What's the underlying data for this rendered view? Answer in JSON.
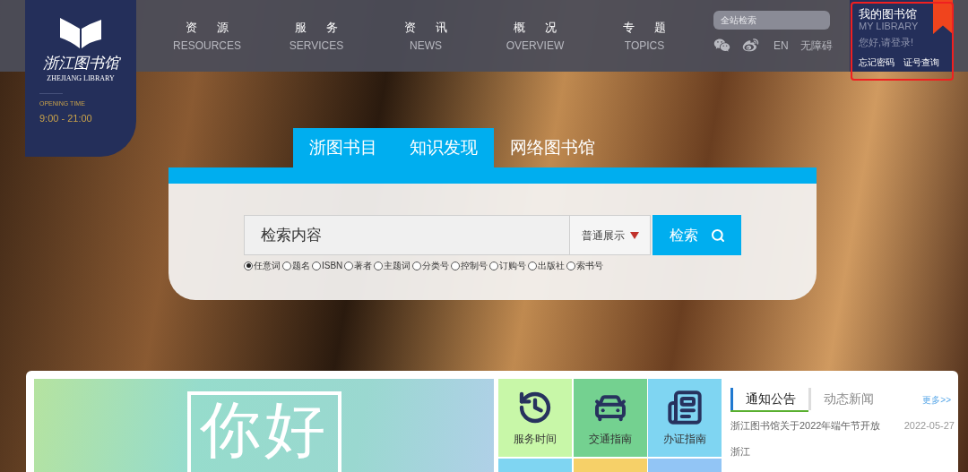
{
  "logo": {
    "name_cn": "浙江图书馆",
    "name_en": "ZHEJIANG LIBRARY",
    "opening_label": "OPENING TIME",
    "opening_hours": "9:00 - 21:00"
  },
  "nav": [
    {
      "cn": "资源",
      "en": "RESOURCES"
    },
    {
      "cn": "服务",
      "en": "SERVICES"
    },
    {
      "cn": "资讯",
      "en": "NEWS"
    },
    {
      "cn": "概况",
      "en": "OVERVIEW"
    },
    {
      "cn": "专题",
      "en": "TOPICS"
    }
  ],
  "site_search": {
    "placeholder": "全站检索"
  },
  "language": "EN",
  "accessibility": "无障碍",
  "my_library": {
    "title": "我的图书馆",
    "subtitle": "MY LIBRARY",
    "greeting": "您好,请登录!",
    "links": [
      "忘记密码",
      "证号查询"
    ]
  },
  "search": {
    "tabs": [
      {
        "label": "浙图书目",
        "selected": true
      },
      {
        "label": "知识发现",
        "selected": true
      },
      {
        "label": "网络图书馆",
        "selected": false
      }
    ],
    "placeholder": "检索内容",
    "display_mode": "普通展示",
    "button": "检索",
    "fields": [
      {
        "label": "任意词",
        "selected": true
      },
      {
        "label": "题名",
        "selected": false
      },
      {
        "label": "ISBN",
        "selected": false
      },
      {
        "label": "著者",
        "selected": false
      },
      {
        "label": "主题词",
        "selected": false
      },
      {
        "label": "分类号",
        "selected": false
      },
      {
        "label": "控制号",
        "selected": false
      },
      {
        "label": "订购号",
        "selected": false
      },
      {
        "label": "出版社",
        "selected": false
      },
      {
        "label": "索书号",
        "selected": false
      }
    ]
  },
  "banner": {
    "text": "你好"
  },
  "tiles": [
    {
      "kind": "clock",
      "label": "服务时间",
      "color": "#c8f7a8"
    },
    {
      "kind": "car",
      "label": "交通指南",
      "color": "#74d190"
    },
    {
      "kind": "card",
      "label": "办证指南",
      "color": "#7fd5f2"
    },
    {
      "kind": "blank",
      "color": "#7fd5f2"
    },
    {
      "kind": "blank",
      "color": "#f6d068"
    },
    {
      "kind": "blank",
      "color": "#92c5f5"
    }
  ],
  "news": {
    "tabs": [
      {
        "label": "通知公告",
        "selected": true
      },
      {
        "label": "动态新闻",
        "selected": false
      }
    ],
    "more": "更多>>",
    "items": [
      {
        "title": "浙江图书馆关于2022年端午节开放",
        "date": "2022-05-27"
      },
      {
        "title": "浙江"
      }
    ]
  }
}
